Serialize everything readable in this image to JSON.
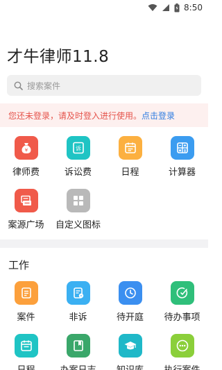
{
  "status": {
    "time": "8:50"
  },
  "app": {
    "title": "才牛律师11.8"
  },
  "search": {
    "placeholder": "搜索案件"
  },
  "login_banner": {
    "message": "您还未登录，请及时登入进行使用。",
    "link": "点击登录"
  },
  "tools": [
    {
      "label": "律师费",
      "icon": "money-bag-icon",
      "color": "#f05a4a"
    },
    {
      "label": "诉讼费",
      "icon": "litigation-doc-icon",
      "color": "#1fc4c4"
    },
    {
      "label": "日程",
      "icon": "calendar-icon",
      "color": "#fcb040"
    },
    {
      "label": "计算器",
      "icon": "calculator-icon",
      "color": "#3b9cf0"
    },
    {
      "label": "案源广场",
      "icon": "case-source-icon",
      "color": "#f05a4a"
    },
    {
      "label": "自定义图标",
      "icon": "custom-grid-icon",
      "color": "#b9b9b9"
    }
  ],
  "work": {
    "title": "工作",
    "items": [
      {
        "label": "案件",
        "icon": "case-icon",
        "color": "#fca03c"
      },
      {
        "label": "非诉",
        "icon": "non-litigation-icon",
        "color": "#3bb0f2"
      },
      {
        "label": "待开庭",
        "icon": "clock-icon",
        "color": "#3b8ff0"
      },
      {
        "label": "待办事项",
        "icon": "todo-check-icon",
        "color": "#2fbf7a"
      },
      {
        "label": "日程",
        "icon": "calendar-icon",
        "color": "#1fc4c4"
      },
      {
        "label": "办案日志",
        "icon": "case-log-icon",
        "color": "#3aa76a"
      },
      {
        "label": "知识库",
        "icon": "graduation-cap-icon",
        "color": "#1fb8c8"
      },
      {
        "label": "执行案件",
        "icon": "more-dots-icon",
        "color": "#8bcf3a"
      }
    ]
  }
}
